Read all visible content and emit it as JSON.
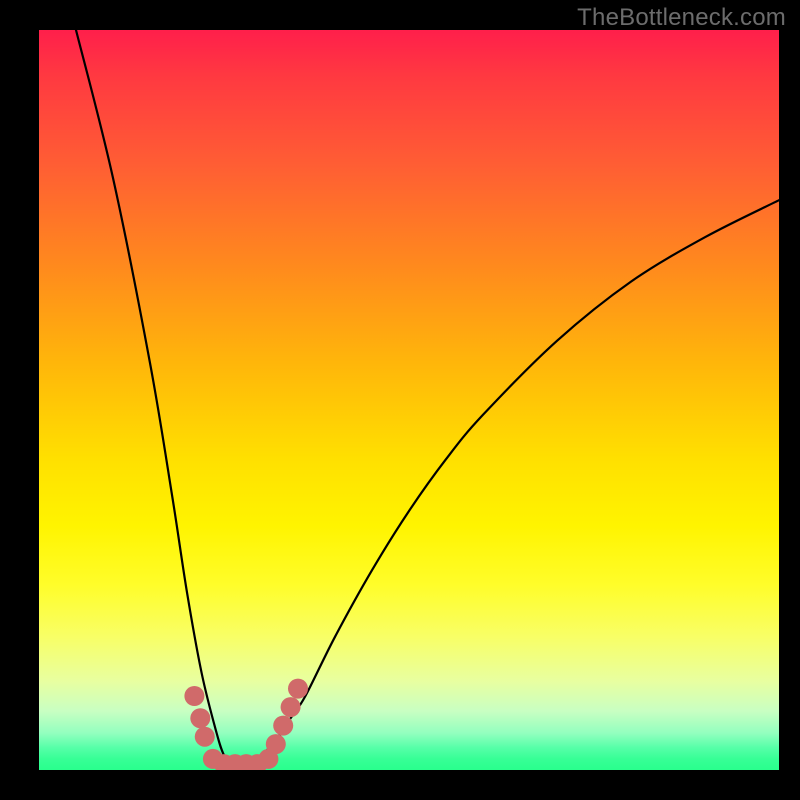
{
  "watermark": "TheBottleneck.com",
  "chart_data": {
    "type": "line",
    "title": "",
    "xlabel": "",
    "ylabel": "",
    "xlim": [
      0,
      100
    ],
    "ylim": [
      0,
      100
    ],
    "series": [
      {
        "name": "bottleneck-curve",
        "x": [
          5,
          10,
          15,
          18,
          20,
          22,
          24,
          25,
          26,
          27,
          28,
          30,
          32,
          34,
          36,
          40,
          45,
          50,
          55,
          60,
          70,
          80,
          90,
          100
        ],
        "values": [
          100,
          80,
          55,
          37,
          24,
          13,
          5,
          2,
          1,
          1,
          1,
          2,
          4,
          7,
          10,
          18,
          27,
          35,
          42,
          48,
          58,
          66,
          72,
          77
        ]
      }
    ],
    "markers": {
      "name": "left-right-dots",
      "color": "#d06a6a",
      "points": [
        {
          "x": 21.0,
          "y": 10.0
        },
        {
          "x": 21.8,
          "y": 7.0
        },
        {
          "x": 22.4,
          "y": 4.5
        },
        {
          "x": 23.5,
          "y": 1.5
        },
        {
          "x": 25.0,
          "y": 0.8
        },
        {
          "x": 26.5,
          "y": 0.8
        },
        {
          "x": 28.0,
          "y": 0.8
        },
        {
          "x": 29.5,
          "y": 0.8
        },
        {
          "x": 31.0,
          "y": 1.5
        },
        {
          "x": 32.0,
          "y": 3.5
        },
        {
          "x": 33.0,
          "y": 6.0
        },
        {
          "x": 34.0,
          "y": 8.5
        },
        {
          "x": 35.0,
          "y": 11.0
        }
      ]
    }
  }
}
